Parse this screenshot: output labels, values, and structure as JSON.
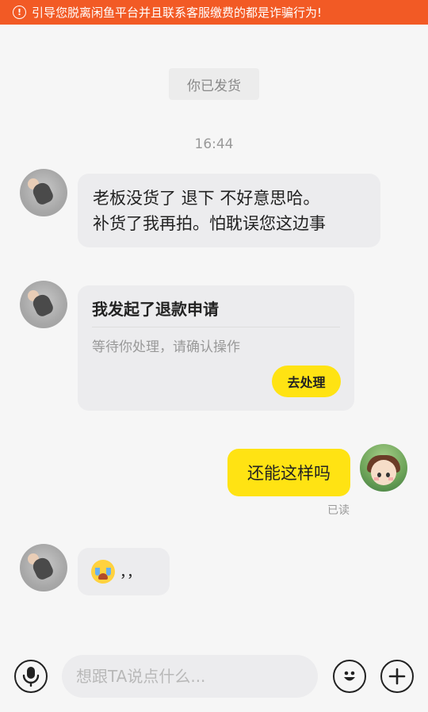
{
  "warning": {
    "text": "引导您脱离闲鱼平台并且联系客服缴费的都是诈骗行为!",
    "icon": "warning-circle-icon"
  },
  "chat": {
    "system_notice": "你已发货",
    "timestamp": "16:44",
    "messages": [
      {
        "sender": "seller",
        "lines": [
          "老板没货了 退下  不好意思哈。",
          "补货了我再拍。怕耽误您这边事"
        ]
      },
      {
        "sender": "seller",
        "type": "refund_card",
        "title": "我发起了退款申请",
        "subtitle": "等待你处理，请确认操作",
        "button": "去处理"
      },
      {
        "sender": "me",
        "text": "还能这样吗",
        "status": "已读"
      },
      {
        "sender": "seller",
        "emoji": "crying-emoji",
        "text": "，，"
      }
    ]
  },
  "input_bar": {
    "placeholder": "想跟TA说点什么...",
    "icons": [
      "microphone-icon",
      "emoji-icon",
      "plus-icon"
    ]
  },
  "colors": {
    "warning": "#f25a25",
    "accent": "#ffe313",
    "bubble_gray": "#ececee",
    "background": "#f6f6f6"
  }
}
